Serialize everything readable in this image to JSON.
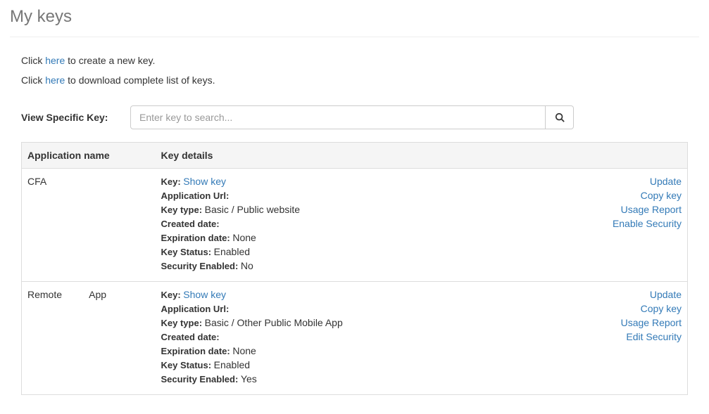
{
  "page": {
    "title": "My keys",
    "intro": {
      "createPrefix": "Click ",
      "createLink": "here",
      "createSuffix": " to create a new key.",
      "downloadPrefix": "Click ",
      "downloadLink": "here",
      "downloadSuffix": " to download complete list of keys."
    },
    "search": {
      "label": "View Specific Key:",
      "placeholder": "Enter key to search..."
    },
    "table": {
      "header": {
        "appName": "Application name",
        "keyDetails": "Key details"
      }
    }
  },
  "labels": {
    "key": "Key: ",
    "showKey": "Show key",
    "appUrl": "Application Url:",
    "keyType": "Key type: ",
    "createdDate": "Created date:",
    "expirationDate": "Expiration date: ",
    "keyStatus": "Key Status: ",
    "securityEnabled": "Security Enabled: "
  },
  "actions": {
    "update": "Update",
    "copyKey": "Copy key",
    "usageReport": "Usage Report",
    "enableSecurity": "Enable Security",
    "editSecurity": "Edit Security"
  },
  "rows": [
    {
      "appName": "CFA",
      "appUrl": "",
      "keyType": "Basic / Public website",
      "createdDate": "",
      "expirationDate": "None",
      "keyStatus": "Enabled",
      "securityEnabled": "No",
      "securityAction": "enableSecurity"
    },
    {
      "appName": "Remote          App",
      "appUrl": "",
      "keyType": "Basic / Other Public Mobile App",
      "createdDate": "",
      "expirationDate": "None",
      "keyStatus": "Enabled",
      "securityEnabled": "Yes",
      "securityAction": "editSecurity"
    }
  ]
}
